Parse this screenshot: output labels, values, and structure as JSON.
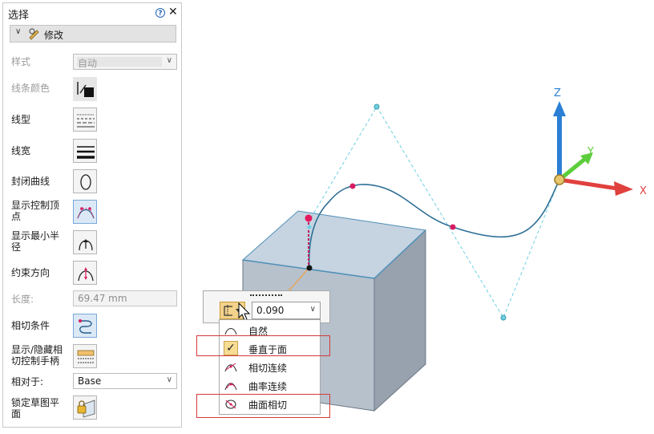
{
  "panel": {
    "title": "选择",
    "section_label": "修改",
    "rows": {
      "style_label": "样式",
      "style_value": "自动",
      "line_color_label": "线条颜色",
      "line_type_label": "线型",
      "line_width_label": "线宽",
      "closed_curve_label": "封闭曲线",
      "show_control_points_label_1": "显示控制顶",
      "show_control_points_label_2": "点",
      "show_min_radius_label_1": "显示最小半",
      "show_min_radius_label_2": "径",
      "constraint_dir_label": "约束方向",
      "length_label": "长度:",
      "length_value": "69.47 mm",
      "tangent_label": "相切条件",
      "toggle_handles_label_1": "显示/隐藏相",
      "toggle_handles_label_2": "切控制手柄",
      "relative_label": "相对于:",
      "relative_value": "Base",
      "lock_plane_label_1": "锁定草图平",
      "lock_plane_label_2": "面"
    }
  },
  "cmdbar": {
    "value": "0.090"
  },
  "menu": {
    "items": [
      {
        "label": "自然",
        "icon": "natural-icon"
      },
      {
        "label": "垂直于面",
        "icon": "check-icon"
      },
      {
        "label": "相切连续",
        "icon": "tangent-continuous-icon"
      },
      {
        "label": "曲率连续",
        "icon": "curvature-continuous-icon"
      },
      {
        "label": "曲面相切",
        "icon": "surface-tangent-icon"
      }
    ]
  },
  "triad": {
    "x_label": "X",
    "y_label": "Y",
    "z_label": "Z"
  },
  "colors": {
    "x_axis": "#e0413e",
    "y_axis": "#5ccd3b",
    "z_axis": "#2b7fd4",
    "curve": "#2f6f96",
    "control_polygon": "#6fd0e3",
    "box_top": "#c6d3e0",
    "box_front": "#b6c1cc",
    "box_right": "#97a2ae",
    "highlight_box": "#d43a3a"
  }
}
